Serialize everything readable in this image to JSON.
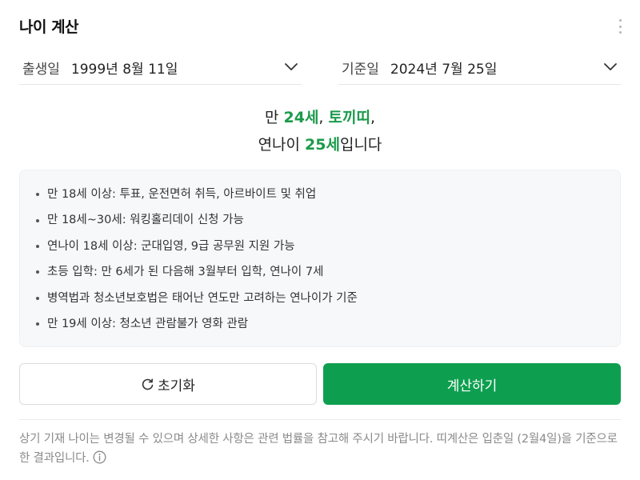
{
  "widget": {
    "title": "나이 계산"
  },
  "birth": {
    "label": "출생일",
    "value": "1999년 8월 11일"
  },
  "reference": {
    "label": "기준일",
    "value": "2024년 7월 25일"
  },
  "result": {
    "line1_prefix": "만 ",
    "age": "24세",
    "sep1": ", ",
    "zodiac": "토끼띠",
    "sep2": ",",
    "line2_prefix": "연나이 ",
    "korean_age": "25세",
    "line2_suffix": "입니다"
  },
  "info": {
    "items": [
      {
        "bold": "만 18세 이상",
        "text": ": 투표, 운전면허 취득, 아르바이트 및 취업"
      },
      {
        "bold": "만 18세~30세",
        "text": ": 워킹홀리데이 신청 가능"
      },
      {
        "bold": "연나이 18세 이상",
        "text": ": 군대입영, 9급 공무원 지원 가능"
      },
      {
        "bold": "초등 입학",
        "text": ": 만 6세가 된 다음해 3월부터 입학, 연나이 7세"
      },
      {
        "bold": "병역법과 청소년보호법",
        "text": "은 태어난 연도만 고려하는 연나이가 기준"
      },
      {
        "bold": "만 19세 이상",
        "text": " : 청소년 관람불가 영화 관람"
      }
    ]
  },
  "buttons": {
    "reset": "초기화",
    "calculate": "계산하기"
  },
  "note": "상기 기재 나이는 변경될 수 있으며 상세한 사항은 관련 법률을 참고해 주시기 바랍니다. 띠계산은 입춘일 (2월4일)을 기준으로 한 결과입니다.",
  "icons": {
    "more": "more-vertical-icon",
    "chevron": "chevron-down-icon",
    "reset": "refresh-icon",
    "info": "info-circle-icon"
  },
  "colors": {
    "accent": "#1c9a4b",
    "button": "#0d9f4f"
  }
}
